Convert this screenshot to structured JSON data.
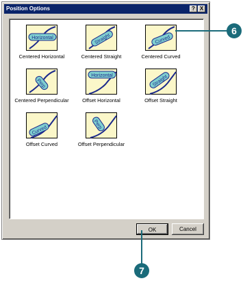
{
  "dialog": {
    "title": "Position Options",
    "help_button": "?",
    "close_button": "X"
  },
  "options": [
    {
      "label": "Centered Horizontal",
      "tag": "Horizontal"
    },
    {
      "label": "Centered Straight",
      "tag": "Straight"
    },
    {
      "label": "Centered Curved",
      "tag": "Curved"
    },
    {
      "label": "Centered Perpendicular",
      "tag": "Perp"
    },
    {
      "label": "Offset Horizontal",
      "tag": "Horizontal"
    },
    {
      "label": "Offset Straight",
      "tag": "Straight"
    },
    {
      "label": "Offset Curved",
      "tag": "Curved"
    },
    {
      "label": "Offset Perpendicular",
      "tag": "Perp"
    }
  ],
  "buttons": {
    "ok": "OK",
    "cancel": "Cancel"
  },
  "callouts": {
    "top": "6",
    "bottom": "7"
  },
  "colors": {
    "thumb_bg": "#fbf7c9",
    "curve": "#1c2a8c",
    "tag_fill": "#7fcfcf",
    "callout": "#1a6b7a"
  }
}
